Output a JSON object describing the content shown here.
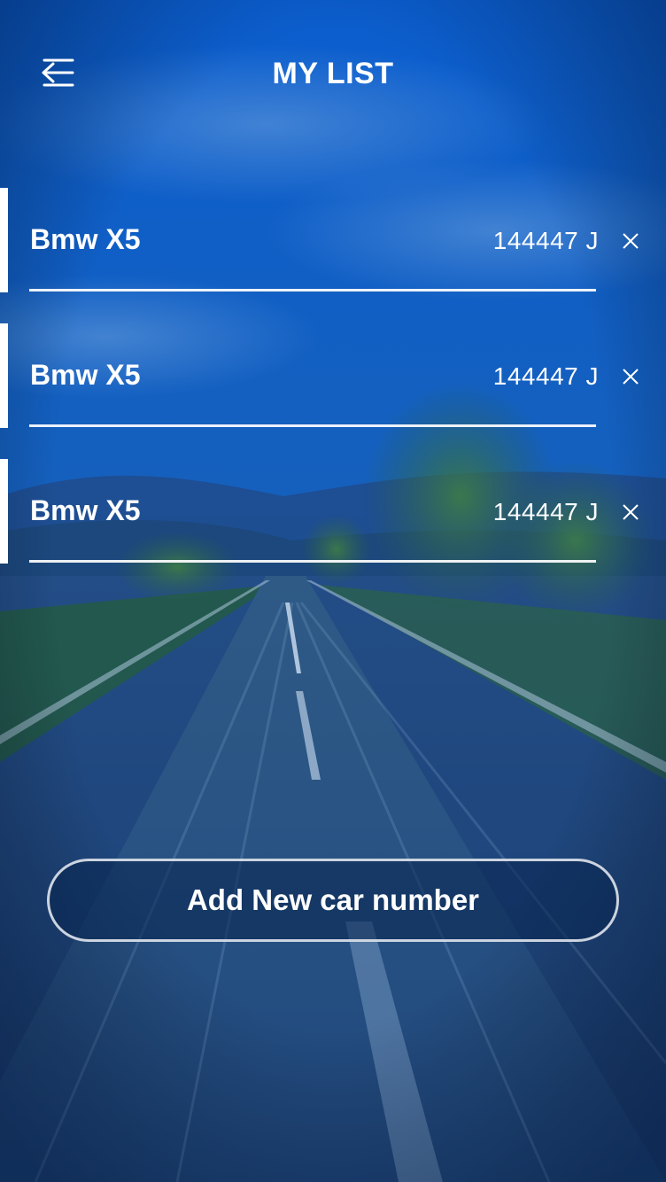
{
  "header": {
    "title": "MY LIST",
    "menu_icon": "menu-back-icon"
  },
  "cars": [
    {
      "name": "Bmw X5",
      "number": "144447 J",
      "delete_icon": "close-icon"
    },
    {
      "name": "Bmw X5",
      "number": "144447 J",
      "delete_icon": "close-icon"
    },
    {
      "name": "Bmw X5",
      "number": "144447 J",
      "delete_icon": "close-icon"
    }
  ],
  "actions": {
    "add_label": "Add New car number"
  },
  "colors": {
    "sky_top": "#0a5cc8",
    "sky_mid": "#1a5eb0",
    "road": "#2c5680",
    "foliage": "#24603a",
    "text": "#ffffff"
  }
}
